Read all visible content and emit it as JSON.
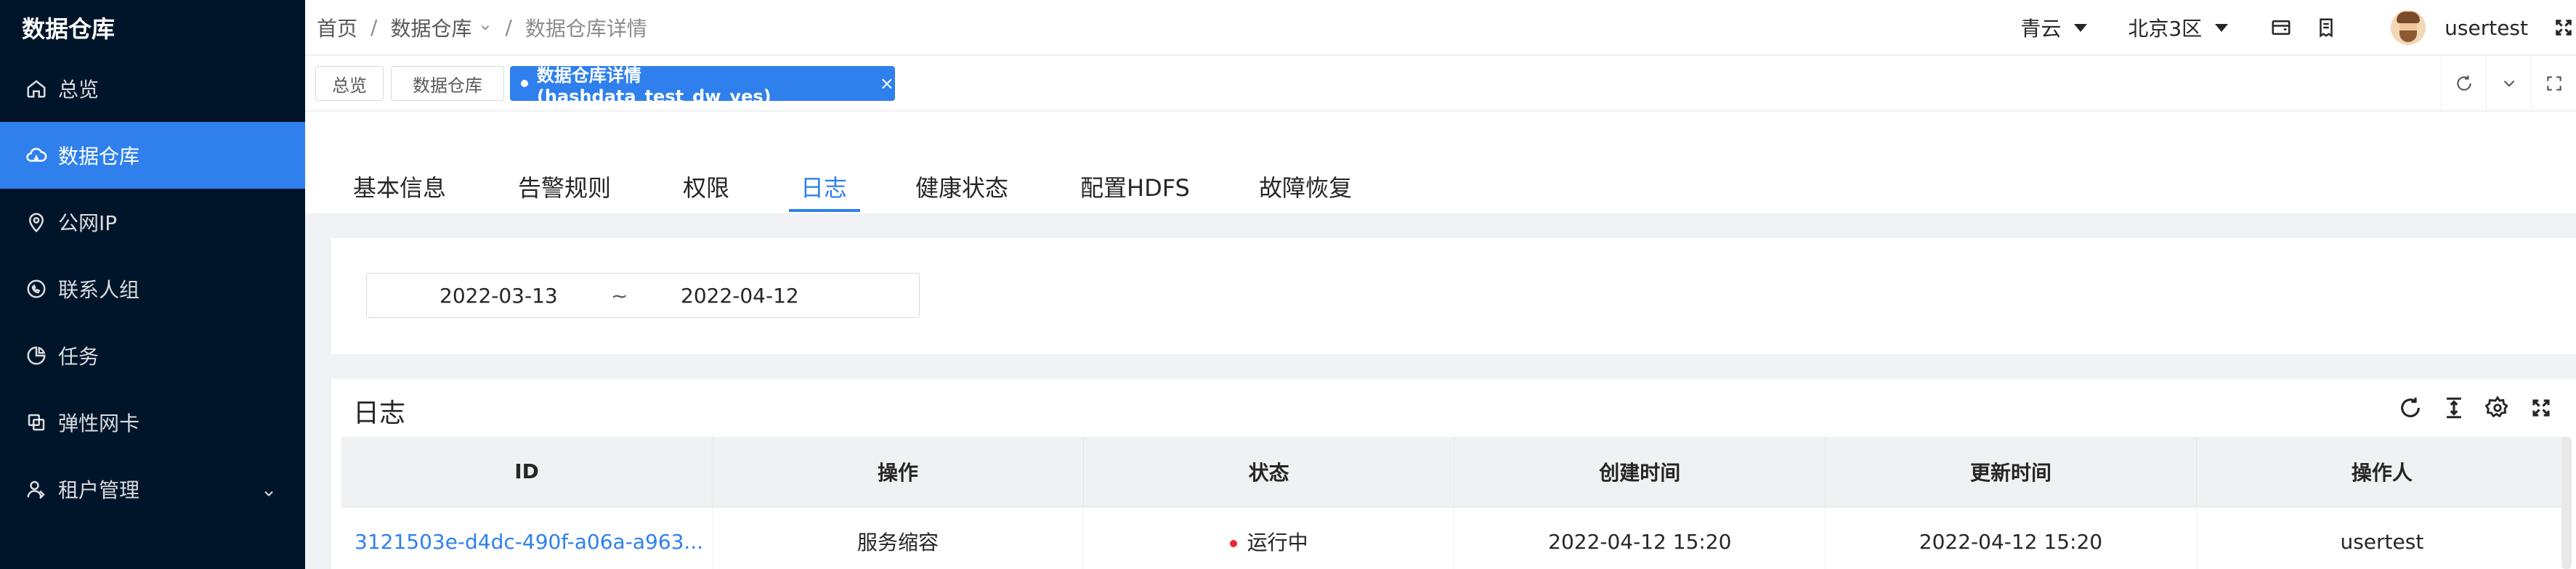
{
  "app": {
    "title": "数据仓库"
  },
  "sidebar": {
    "items": [
      {
        "label": "总览",
        "icon": "home-icon"
      },
      {
        "label": "数据仓库",
        "icon": "cloud-icon",
        "active": true
      },
      {
        "label": "公网IP",
        "icon": "location-icon"
      },
      {
        "label": "联系人组",
        "icon": "chat-icon"
      },
      {
        "label": "任务",
        "icon": "pie-chart-icon"
      },
      {
        "label": "弹性网卡",
        "icon": "network-card-icon"
      },
      {
        "label": "租户管理",
        "icon": "user-group-icon"
      }
    ]
  },
  "breadcrumb": {
    "home": "首页",
    "section": "数据仓库",
    "current": "数据仓库详情",
    "sep": "/"
  },
  "header": {
    "provider": "青云",
    "zone": "北京3区",
    "username": "usertest"
  },
  "page_tabs": {
    "items": [
      "总览",
      "数据仓库"
    ],
    "active": "数据仓库详情(hashdata_test_dw_yes)",
    "close": "×"
  },
  "sub_tabs": {
    "items": [
      "基本信息",
      "告警规则",
      "权限",
      "日志",
      "健康状态",
      "配置HDFS",
      "故障恢复"
    ],
    "active_index": 3
  },
  "filter": {
    "start_date": "2022-03-13",
    "separator": "~",
    "end_date": "2022-04-12"
  },
  "log": {
    "title": "日志",
    "columns": [
      "ID",
      "操作",
      "状态",
      "创建时间",
      "更新时间",
      "操作人"
    ],
    "rows": [
      {
        "id": "3121503e-d4dc-490f-a06a-a963...",
        "operation": "服务缩容",
        "status": "运行中",
        "created": "2022-04-12 15:20",
        "updated": "2022-04-12 15:20",
        "operator": "usertest"
      }
    ]
  },
  "colors": {
    "sidebar_bg": "#001529",
    "accent": "#2f80ed",
    "status_running": "#f5222d"
  }
}
